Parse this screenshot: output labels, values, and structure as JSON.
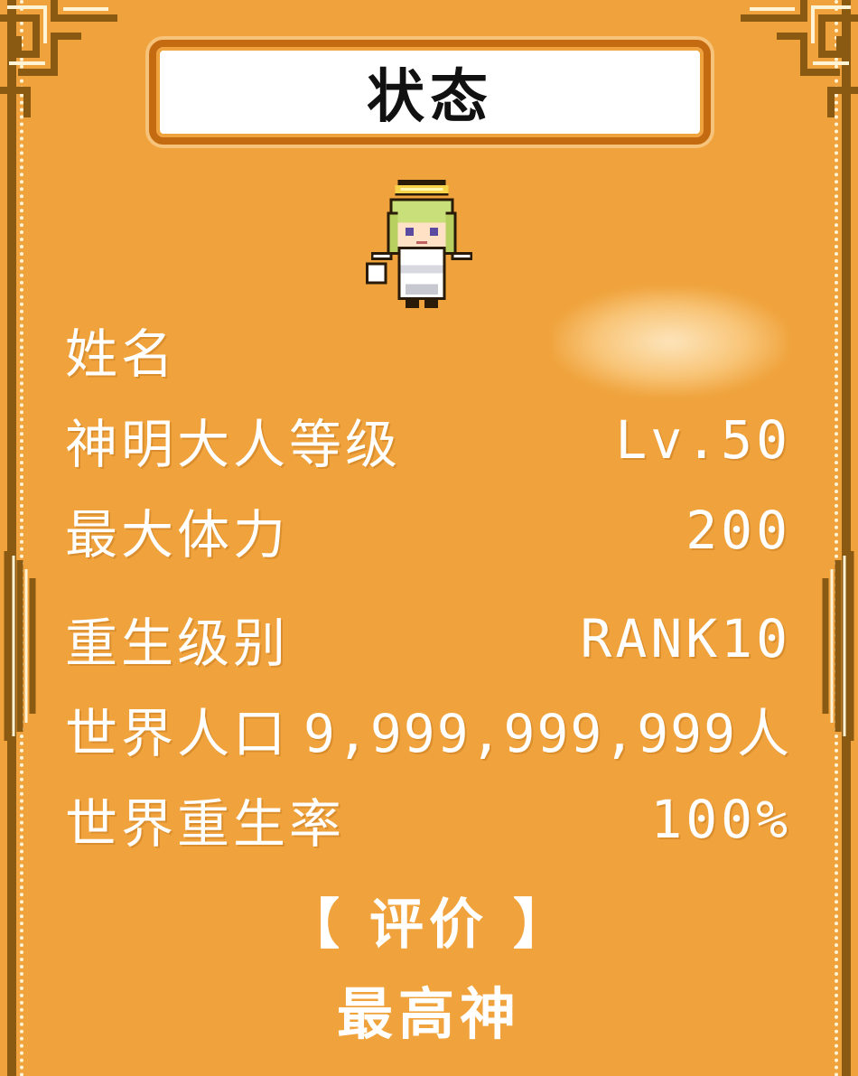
{
  "title": "状态",
  "stats": [
    {
      "label": "姓名",
      "value": ""
    },
    {
      "label": "神明大人等级",
      "value": "Lv.50"
    },
    {
      "label": "最大体力",
      "value": "200"
    },
    {
      "label": "重生级别",
      "value": "RANK10"
    },
    {
      "label": "世界人口",
      "value": "9,999,999,999人"
    },
    {
      "label": "世界重生率",
      "value": "100%"
    }
  ],
  "evaluation": {
    "header": "【 评价 】",
    "value": "最高神"
  },
  "colors": {
    "background": "#f0a33c",
    "frame": "#8a5a12",
    "title_border": "#c46a10",
    "text": "#ffffff"
  },
  "icons": {
    "avatar": "angel-girl-sprite"
  }
}
